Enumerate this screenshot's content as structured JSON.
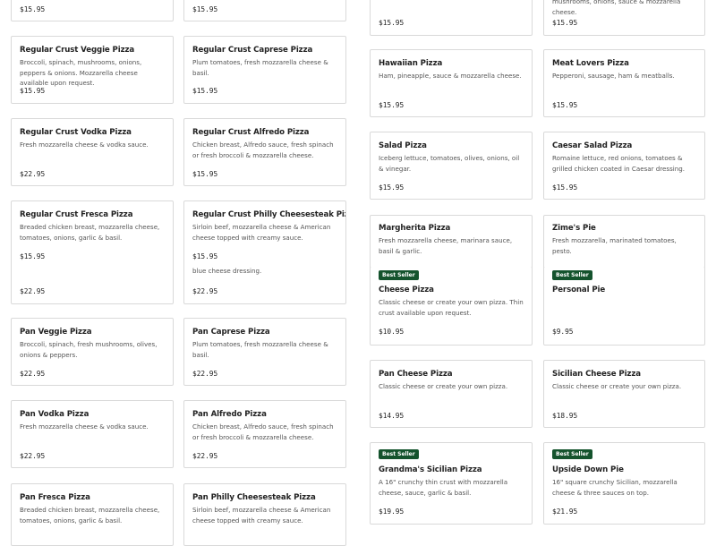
{
  "left_column": [
    {
      "price": "$15.95"
    },
    {
      "price": "$15.95"
    },
    {
      "name": "Regular Crust Veggie Pizza",
      "desc": "Broccoli, spinach, mushrooms, onions, peppers & onions. Mozzarella cheese available upon request.",
      "price": "$15.95"
    },
    {
      "name": "Regular Crust Caprese Pizza",
      "desc": "Plum tomatoes, fresh mozzarella cheese & basil.",
      "price": "$15.95"
    },
    {
      "name": "Regular Crust Vodka Pizza",
      "desc": "Fresh mozzarella cheese & vodka sauce.",
      "price": "$22.95"
    },
    {
      "name": "Regular Crust Alfredo Pizza",
      "desc": "Chicken breast, Alfredo sauce, fresh spinach or fresh broccoli & mozzarella cheese.",
      "price": "$15.95"
    },
    {
      "name": "Regular Crust Fresca Pizza",
      "desc": "Breaded chicken breast, mozzarella cheese, tomatoes, onions, garlic & basil.",
      "price": "$15.95"
    },
    {
      "name": "Regular Crust Philly Cheesesteak Pizza",
      "desc": "Sirloin beef, mozzarella cheese & American cheese topped with creamy sauce.",
      "price": "$15.95"
    },
    {
      "price": "$22.95"
    },
    {
      "price": "$22.95",
      "desc": "blue cheese dressing."
    },
    {
      "name": "Pan Veggie Pizza",
      "desc": "Broccoli, spinach, fresh mushrooms, olives, onions & peppers.",
      "price": "$22.95"
    },
    {
      "name": "Pan Caprese Pizza",
      "desc": "Plum tomatoes, fresh mozzarella cheese & basil.",
      "price": "$22.95"
    },
    {
      "name": "Pan Vodka Pizza",
      "desc": "Fresh mozzarella cheese & vodka sauce.",
      "price": "$22.95"
    },
    {
      "name": "Pan Alfredo Pizza",
      "desc": "Chicken breast, Alfredo sauce, fresh spinach or fresh broccoli & mozzarella cheese.",
      "price": "$22.95"
    },
    {
      "name": "Pan Fresca Pizza",
      "desc": "Breaded chicken breast, mozzarella cheese, tomatoes, onions, garlic & basil."
    },
    {
      "name": "Pan Philly Cheesesteak Pizza",
      "desc": "Sirloin beef, mozzarella cheese & American cheese topped with creamy sauce."
    }
  ],
  "right_column": [
    {
      "price": "$15.95"
    },
    {
      "desc": "mushrooms, onions, sauce & mozzarella cheese.",
      "price": "$15.95"
    },
    {
      "name": "Hawaiian Pizza",
      "desc": "Ham, pineapple, sauce & mozzarella cheese.",
      "price": "$15.95"
    },
    {
      "name": "Meat Lovers Pizza",
      "desc": "Pepperoni, sausage, ham & meatballs.",
      "price": "$15.95"
    },
    {
      "name": "Salad Pizza",
      "desc": "Iceberg lettuce, tomatoes, olives, onions, oil & vinegar.",
      "price": "$15.95"
    },
    {
      "name": "Caesar Salad Pizza",
      "desc": "Romaine lettuce, red onions, tomatoes & grilled chicken coated in Caesar dressing.",
      "price": "$15.95"
    },
    {
      "name": "Margherita Pizza",
      "desc": "Fresh mozzarella cheese, marinara sauce, basil & garlic."
    },
    {
      "name": "Zime's Pie",
      "desc": "Fresh mozzarella, marinated tomatoes, pesto."
    },
    {
      "badge": "Best Seller",
      "name": "Cheese Pizza",
      "desc": "Classic cheese or create your own pizza. Thin crust available upon request.",
      "price": "$10.95"
    },
    {
      "badge": "Best Seller",
      "name": "Personal Pie",
      "price": "$9.95"
    },
    {
      "name": "Pan Cheese Pizza",
      "desc": "Classic cheese or create your own pizza.",
      "price": "$14.95"
    },
    {
      "name": "Sicilian Cheese Pizza",
      "desc": "Classic cheese or create your own pizza.",
      "price": "$18.95"
    },
    {
      "badge": "Best Seller",
      "name": "Grandma's Sicilian Pizza",
      "desc": "A 16\" crunchy thin crust with mozzarella cheese, sauce, garlic & basil.",
      "price": "$19.95"
    },
    {
      "badge": "Best Seller",
      "name": "Upside Down Pie",
      "desc": "16\" square crunchy Sicilian, mozzarella cheese & three sauces on top.",
      "price": "$21.95"
    }
  ]
}
